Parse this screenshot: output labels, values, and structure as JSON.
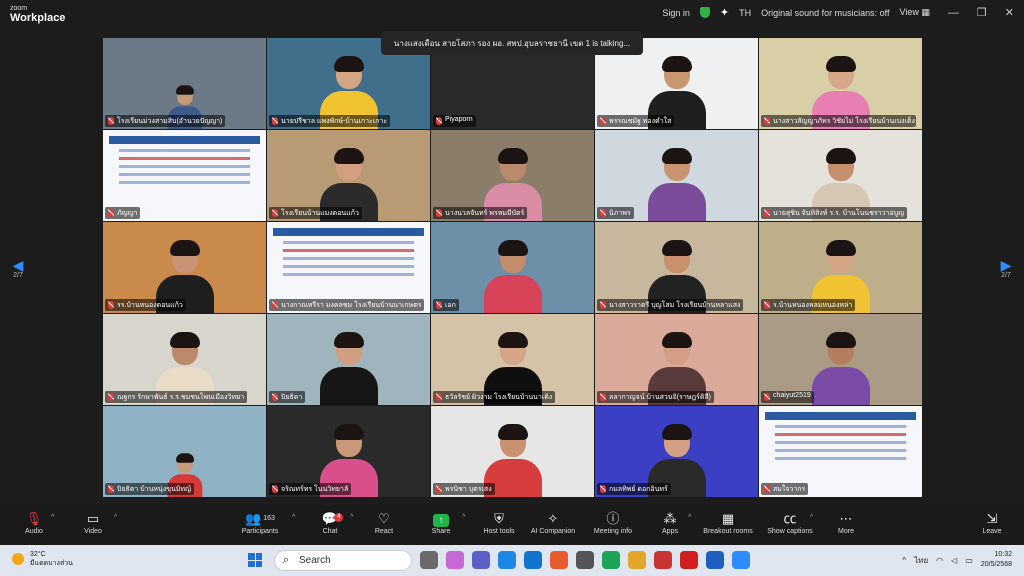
{
  "app": {
    "brand_small": "zoom",
    "brand_big": "Workplace",
    "sign_in": "Sign in",
    "lang": "TH",
    "sound_status": "Original sound for musicians: off",
    "view": "View"
  },
  "talking_banner": "นางแสงเดือน สายโสภา รอง ผอ. สพป.อุบลราชธานี เขต 1 is talking...",
  "pagination": {
    "left": "2/7",
    "right": "2/7"
  },
  "tiles": [
    {
      "name": "โรงเรียนม่วงสามสิบ(อำนวยปัญญา)",
      "kind": "room",
      "bg": "#6b7a86",
      "skin": "#c89a7c",
      "shirt": "#3c5a8c"
    },
    {
      "name": "นายปรีชาล แพงพักษ์-บ้านเกาะเกาะ",
      "kind": "person",
      "bg": "#3f6f8a",
      "skin": "#d3a584",
      "shirt": "#f1c232"
    },
    {
      "name": "Piyaporn",
      "kind": "blank",
      "bg": "#2a2a2a",
      "skin": "#c89a7c",
      "shirt": "#555"
    },
    {
      "name": "พรรณชมัฐ ทองคำใส",
      "kind": "person",
      "bg": "#eef0f2",
      "skin": "#c9976f",
      "shirt": "#1f1f1f"
    },
    {
      "name": "นางสาวสัญญาภัทร วิชัยไม่ โรงเรียนบ้านเบงเต็ง",
      "kind": "person",
      "bg": "#d9cfa7",
      "skin": "#d6a889",
      "shirt": "#e87fb3"
    },
    {
      "name": "ภัญญา",
      "kind": "slide",
      "bg": "#f5f7fb",
      "skin": "#c89a7c",
      "shirt": "#555"
    },
    {
      "name": "โรงเรียนบ้านแมงดอนแก้ว",
      "kind": "person",
      "bg": "#b89a74",
      "skin": "#d2a07e",
      "shirt": "#2b2b2b"
    },
    {
      "name": "นางนวลจันทร์ พรหมมีบัตร์",
      "kind": "person",
      "bg": "#8a7d6a",
      "skin": "#b98a6c",
      "shirt": "#d98ca4"
    },
    {
      "name": "นิภาพร",
      "kind": "person",
      "bg": "#cfd8df",
      "skin": "#c89472",
      "shirt": "#7b4c9a"
    },
    {
      "name": "นายสุชิน จันทิสิงห์ ร.ร. บ้านโนนชราวาอบูญ",
      "kind": "person",
      "bg": "#e4e2da",
      "skin": "#c58e6c",
      "shirt": "#d5c7b4"
    },
    {
      "name": "รร.บ้านหนองดอนแก้ว",
      "kind": "person",
      "bg": "#c98a4b",
      "skin": "#c99375",
      "shirt": "#1e1e1e"
    },
    {
      "name": "นางกาณหรีรา มงคลชม โรงเรียนบ้านนาเกษตร",
      "kind": "slide",
      "bg": "#f5f7fb",
      "skin": "#c89a7c",
      "shirt": "#d97c7c"
    },
    {
      "name": "เอก",
      "kind": "person",
      "bg": "#6d8fa8",
      "skin": "#c18d6b",
      "shirt": "#d9435a"
    },
    {
      "name": "นางสาวราตรี บุญโสม โรงเรียนบ้านหลาแสง",
      "kind": "person",
      "bg": "#c7b79c",
      "skin": "#c8906c",
      "shirt": "#222"
    },
    {
      "name": "ร.บ้านหนองหลมหนองหล่า",
      "kind": "person",
      "bg": "#bfae8a",
      "skin": "#d4a686",
      "shirt": "#f1c232"
    },
    {
      "name": "ณฐกร รักษาพันธ์ ร.ร.ชมชนโพนเมืองวิทยา",
      "kind": "person",
      "bg": "#d8d6cc",
      "skin": "#bb8a6b",
      "shirt": "#e8dcc8"
    },
    {
      "name": "ปิยธิดา",
      "kind": "person",
      "bg": "#9fb4bd",
      "skin": "#cf9f80",
      "shirt": "#161616"
    },
    {
      "name": "ธวัลรัชย์ ผิวงาม โรงเรียนบ้านนาเติง",
      "kind": "person",
      "bg": "#d4c3a6",
      "skin": "#d5a58a",
      "shirt": "#0f0f0f"
    },
    {
      "name": "ลลากาญจน์ บ้านสวนจิ(ราษฎร์ดิลี)",
      "kind": "person",
      "bg": "#d9a99a",
      "skin": "#d29e85",
      "shirt": "#5a3b3b"
    },
    {
      "name": "chaiyut2519",
      "kind": "person",
      "bg": "#a99b86",
      "skin": "#b47d5e",
      "shirt": "#7a4ca8"
    },
    {
      "name": "ปิยธิดา บ้านหนุ่งขุนมิทญ์",
      "kind": "room",
      "bg": "#8fb2c4",
      "skin": "#c89a7c",
      "shirt": "#d43a3a"
    },
    {
      "name": "จริณทร์ทร โนนวิทยาลั",
      "kind": "person",
      "bg": "#2a2a2a",
      "skin": "#c99878",
      "shirt": "#d94f8c"
    },
    {
      "name": "พรนิชา บุตรเสง",
      "kind": "person",
      "bg": "#e6e6e6",
      "skin": "#c8916f",
      "shirt": "#d63d3d"
    },
    {
      "name": "กมลทิพย์ ดอกอินทร์",
      "kind": "person",
      "bg": "#3a3fc4",
      "skin": "#d2a084",
      "shirt": "#2a2a2a"
    },
    {
      "name": "สมใจวากร",
      "kind": "slide",
      "bg": "#f5f7fb",
      "skin": "#c89a7c",
      "shirt": "#e2e2e2"
    }
  ],
  "toolbar": {
    "audio": "Audio",
    "video": "Video",
    "participants": "Participants",
    "participants_count": "163",
    "chat": "Chat",
    "chat_badge": "4",
    "react": "React",
    "share": "Share",
    "host_tools": "Host tools",
    "ai_companion": "AI Companion",
    "meeting_info": "Meeting info",
    "apps": "Apps",
    "breakout": "Breakout rooms",
    "captions": "Show captions",
    "more": "More",
    "leave": "Leave"
  },
  "taskbar": {
    "temp": "32°C",
    "weather_text": "มีแดดบางส่วน",
    "search_placeholder": "Search",
    "time": "10:32",
    "date": "20/5/2568",
    "lang": "ไทย"
  },
  "colors": {
    "accent": "#2d8cff",
    "mute_red": "#e23b3b",
    "share_green": "#22b34a"
  }
}
